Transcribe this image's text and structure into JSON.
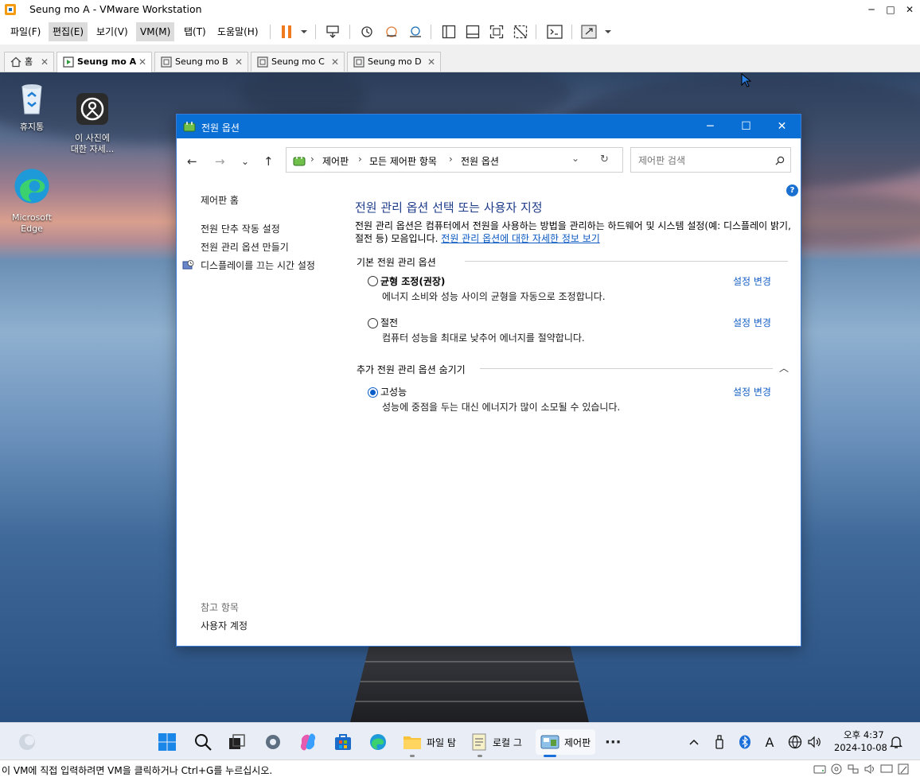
{
  "vm_window": {
    "title": "Seung mo A - VMware Workstation",
    "minimize": "─",
    "maximize": "□",
    "close": "✕"
  },
  "menu": {
    "items": [
      "파일(F)",
      "편집(E)",
      "보기(V)",
      "VM(M)",
      "탭(T)",
      "도움말(H)"
    ]
  },
  "tabs": [
    {
      "label": "홈",
      "icon": "home-icon"
    },
    {
      "label": "Seung mo A",
      "icon": "vm-running-icon"
    },
    {
      "label": "Seung mo B",
      "icon": "vm-icon"
    },
    {
      "label": "Seung mo C",
      "icon": "vm-icon"
    },
    {
      "label": "Seung mo D",
      "icon": "vm-icon"
    }
  ],
  "desktop": {
    "icons": [
      {
        "label": "휴지통",
        "icon": "recycle-bin-icon"
      },
      {
        "label": "이 사진에\n대한 자세...",
        "icon": "learn-about-picture-icon"
      },
      {
        "label": "Microsoft\nEdge",
        "icon": "edge-icon"
      }
    ]
  },
  "power_window": {
    "title": "전원 옵션",
    "breadcrumb": [
      "제어판",
      "모든 제어판 항목",
      "전원 옵션"
    ],
    "search_placeholder": "제어판 검색",
    "sidebar": {
      "home": "제어판 홈",
      "links": [
        "전원 단추 작동 설정",
        "전원 관리 옵션 만들기",
        "디스플레이를 끄는 시간 설정"
      ],
      "see_also_header": "참고 항목",
      "see_also": [
        "사용자 계정"
      ]
    },
    "heading": "전원 관리 옵션 선택 또는 사용자 지정",
    "description": "전원 관리 옵션은 컴퓨터에서 전원을 사용하는 방법을 관리하는 하드웨어 및 시스템 설정(예: 디스플레이 밝기, 절전 등) 모음입니다.",
    "description_link": "전원 관리 옵션에 대한 자세한 정보 보기",
    "basic_group": "기본 전원 관리 옵션",
    "extra_group": "추가 전원 관리 옵션 숨기기",
    "plans": [
      {
        "name": "균형 조정(권장)",
        "desc": "에너지 소비와 성능 사이의 균형을 자동으로 조정합니다.",
        "link": "설정 변경",
        "selected": false
      },
      {
        "name": "절전",
        "desc": "컴퓨터 성능을 최대로 낮추어 에너지를 절약합니다.",
        "link": "설정 변경",
        "selected": false
      },
      {
        "name": "고성능",
        "desc": "성능에 중점을 두는 대신 에너지가 많이 소모될 수 있습니다.",
        "link": "설정 변경",
        "selected": true
      }
    ]
  },
  "taskbar": {
    "apps": [
      {
        "label": "파일 탐",
        "icon": "folder-icon"
      },
      {
        "label": "로컬 그",
        "icon": "notepad-icon"
      },
      {
        "label": "제어판",
        "icon": "control-panel-icon"
      }
    ],
    "clock_time": "오후 4:37",
    "clock_date": "2024-10-08",
    "ime": "A"
  },
  "status": {
    "text": "이 VM에 직접 입력하려면 VM을 클릭하거나 Ctrl+G를 누르십시오."
  }
}
